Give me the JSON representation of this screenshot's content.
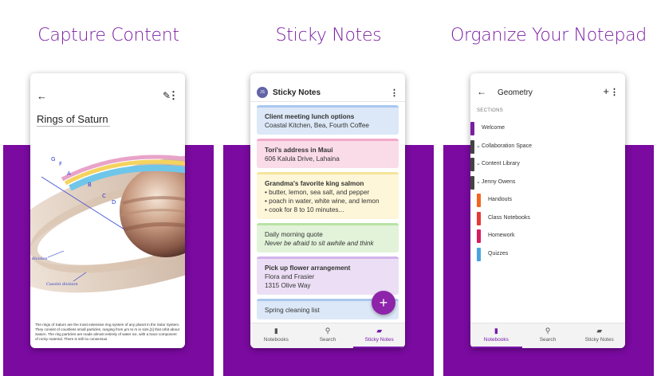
{
  "panels": {
    "capture": {
      "heading": "Capture Content"
    },
    "sticky": {
      "heading": "Sticky Notes"
    },
    "organize": {
      "heading": "Organize Your Notepad"
    }
  },
  "capture_screen": {
    "page_title": "Rings of Saturn",
    "ring_labels": [
      "G",
      "F",
      "A",
      "B",
      "C",
      "D"
    ],
    "annotations": [
      "division",
      "Cassini division"
    ],
    "caption": "The rings of Saturn are the most extensive ring system of any planet in the Solar System. They consist of countless small particles, ranging from μm to m in size,[1] that orbit about Saturn. The ring particles are made almost entirely of water ice, with a trace component of rocky material. There is still no consensus"
  },
  "sticky_screen": {
    "avatar_initials": "JS",
    "title": "Sticky Notes",
    "notes": [
      {
        "title": "Client meeting lunch options",
        "lines": [
          "Coastal Kitchen, Bea, Fourth Coffee"
        ],
        "style": "normal",
        "bg": "#dce8f7",
        "border": "#a9c8ee"
      },
      {
        "title": "Tori's address in Maui",
        "lines": [
          "606 Kalula Drive, Lahaina"
        ],
        "style": "normal",
        "bg": "#fadbe8",
        "border": "#f3a9c8"
      },
      {
        "title": "Grandma's favorite king salmon",
        "lines": [
          "• butter, lemon, sea salt, and pepper",
          "• poach in water, white wine, and lemon",
          "• cook for 8 to 10 minutes..."
        ],
        "style": "normal",
        "bg": "#fdf6d8",
        "border": "#f6e49b"
      },
      {
        "title": "Daily morning quote",
        "lines": [
          "Never be afraid to sit awhile and think"
        ],
        "style": "quote",
        "bg": "#e2f3d9",
        "border": "#b9e2a5"
      },
      {
        "title": "Pick up flower arrangement",
        "lines": [
          "Flora and Frasier",
          "1315 Olive Way"
        ],
        "style": "normal",
        "bg": "#ecdff5",
        "border": "#d2b3ea"
      },
      {
        "title": "Spring cleaning list",
        "lines": [],
        "style": "plain",
        "bg": "#dce8f7",
        "border": "#a9c8ee"
      }
    ],
    "fab_label": "+",
    "nav": [
      {
        "label": "Notebooks",
        "icon": "notebook-icon",
        "active": false
      },
      {
        "label": "Search",
        "icon": "search-icon",
        "active": false
      },
      {
        "label": "Sticky Notes",
        "icon": "sticky-note-icon",
        "active": true
      }
    ]
  },
  "organize_screen": {
    "title": "Geometry",
    "sections_label": "SECTIONS",
    "sections": [
      {
        "label": "Welcome",
        "color": "#7a1fa2",
        "level": 0,
        "group": false
      },
      {
        "label": "Collaboration Space",
        "color": "#444444",
        "level": 0,
        "group": true
      },
      {
        "label": "Content Library",
        "color": "#444444",
        "level": 0,
        "group": true
      },
      {
        "label": "Jenny Owens",
        "color": "#444444",
        "level": 0,
        "group": true
      },
      {
        "label": "Handouts",
        "color": "#f26522",
        "level": 1,
        "group": false
      },
      {
        "label": "Class Notebooks",
        "color": "#e53935",
        "level": 1,
        "group": false
      },
      {
        "label": "Homework",
        "color": "#d81b60",
        "level": 1,
        "group": false
      },
      {
        "label": "Quizzes",
        "color": "#4aa3df",
        "level": 1,
        "group": false
      }
    ],
    "nav": [
      {
        "label": "Notebooks",
        "icon": "notebook-icon",
        "active": true
      },
      {
        "label": "Search",
        "icon": "search-icon",
        "active": false
      },
      {
        "label": "Sticky Notes",
        "icon": "sticky-note-icon",
        "active": false
      }
    ]
  },
  "colors": {
    "brand_purple": "#7a0aa0",
    "accent": "#7719aa",
    "fab": "#8e24aa"
  }
}
